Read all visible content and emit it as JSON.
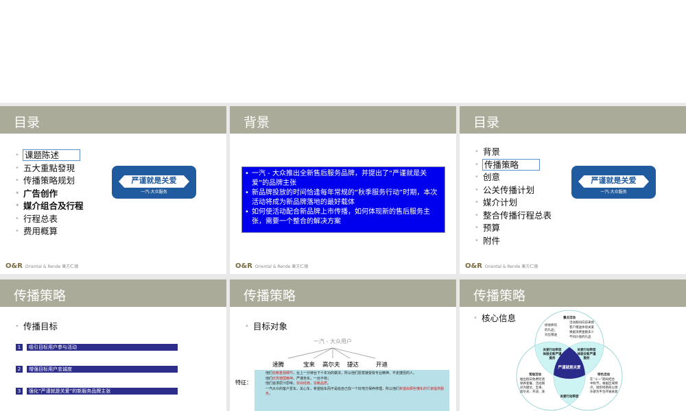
{
  "slides": [
    {
      "title": "目录",
      "items": [
        "课题陈述",
        "五大重點發現",
        "传播策略规划",
        "广告创作",
        "媒介组合及行程",
        "行程总表",
        "费用概算"
      ],
      "logo": {
        "main": "严谨就是关爱",
        "sub": "一汽-大众服务"
      },
      "footer": {
        "brand": "O&R",
        "text": "Oriental & Rende 東方仁德"
      }
    },
    {
      "title": "背景",
      "bullets": [
        "一汽 - 大众推出全新售后服务品牌，并提出了“严谨就是关爱”的品牌主张",
        "新品牌投放的时间恰逢每年常规的“秋季服务行动”时期，本次活动将成为新品牌落地的最好载体",
        "如何使活动配合新品牌上市传播，如何体现新的售后服务主张，需要一个整合的解决方案"
      ],
      "footer": {
        "brand": "O&R",
        "text": "Oriental & Rende 東方仁德"
      }
    },
    {
      "title": "目录",
      "items": [
        "背景",
        "传播策略",
        "创意",
        "公关传播计划",
        "媒介计划",
        "整合传播行程总表",
        "预算",
        "附件"
      ],
      "logo": {
        "main": "严谨就是关爱",
        "sub": "一汽-大众服务"
      },
      "footer": {
        "brand": "O&R",
        "text": "Oriental & Rende 東方仁德"
      }
    },
    {
      "title": "传播策略",
      "heading": "传播目标",
      "goals": [
        {
          "n": "1",
          "t": "吸引目标用户参与活动"
        },
        {
          "n": "2",
          "t": "增强目标用户忠诚度"
        },
        {
          "n": "3",
          "t": "强化“严谨就是关爱”的新服务品牌主张"
        }
      ]
    },
    {
      "title": "传播策略",
      "heading": "目标对象",
      "root": "一汽 - 大众用户",
      "models": [
        "速腾",
        "宝来",
        "高尔夫",
        "捷达",
        "开迪"
      ],
      "feature_label": "特征：",
      "features": {
        "l1a": "他们",
        "l1r": "信赖重视细节",
        "l1b": "，台上一分钟台下十年功的做法，所以他们愿意接受有专业精神、不走捷径的人。",
        "l2a": "他们",
        "l2r": "欣赏德国精神",
        "l2b": "，严谨务实，一丝不苟；",
        "l3a": "他们追求原汁原味，",
        "l3r": "崇尚经典，信赖品质",
        "l3b": "。",
        "l4": "一汽大众的客户爱车，关心车，希望给车而不是给自己找一个好地方保养修理，所以他们",
        "l4r": "希望由那些懂车的行家提供服务",
        "l4b": "。"
      }
    },
    {
      "title": "传播策略",
      "heading": "核心信息",
      "venn": {
        "center": "严谨就是关爱",
        "top_title": "重点活动",
        "top_lines": [
          "活动期间向前来修",
          "客户赠送体现关爱",
          "根据消费金额多少",
          "不同价值的礼品"
        ],
        "top_left": [
          "修保养的",
          "的礼品；",
          "对应赠送"
        ],
        "overlap_left": [
          "关爱行动带您",
          "体验全新严谨",
          "服务"
        ],
        "overlap_right": [
          "关爱行动带您",
          "体验全新严谨",
          "服务"
        ],
        "overlap_bottom": [
          "关爱行动带您"
        ],
        "left_title": "常规活动",
        "left_lines": [
          "推出假日免费检测",
          "保养套餐，活动期",
          "间为捷达、宝来、",
          "高尔夫、开迪、速"
        ],
        "right_title": "特色活动",
        "right_lines": [
          "在“十一”期间结合",
          "中秋节，根据区域特",
          "点，组织经销商以俱",
          "乐部为平台开展关爱"
        ]
      }
    }
  ],
  "colors": {
    "header": "#abab99",
    "accent_blue": "#0000ee",
    "navy": "#2d2d8c",
    "venn_center": "#2a2a8a"
  }
}
